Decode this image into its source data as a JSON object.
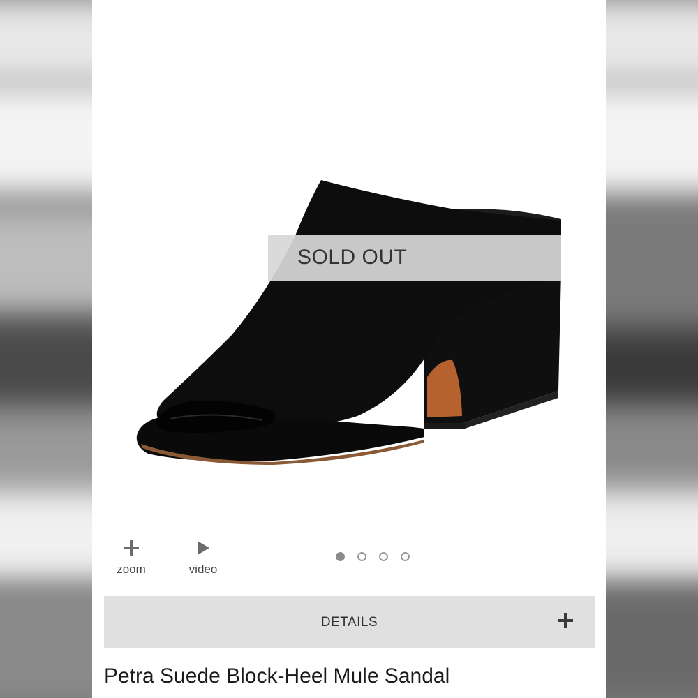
{
  "product_image": {
    "badge": "SOLD OUT",
    "alt": "Black suede block-heel mule sandal"
  },
  "media_controls": {
    "zoom_label": "zoom",
    "zoom_icon": "plus-icon",
    "video_label": "video",
    "video_icon": "play-icon"
  },
  "carousel": {
    "slide_count": 4,
    "active_index": 0
  },
  "details": {
    "label": "DETAILS",
    "icon": "plus-icon"
  },
  "product": {
    "title": "Petra Suede Block-Heel Mule Sandal"
  },
  "colors": {
    "badge_bg": "#d7d7d7",
    "details_bg": "#e0e0e0",
    "shoe": "#0d0d0d",
    "heel_lining": "#b5622f"
  }
}
